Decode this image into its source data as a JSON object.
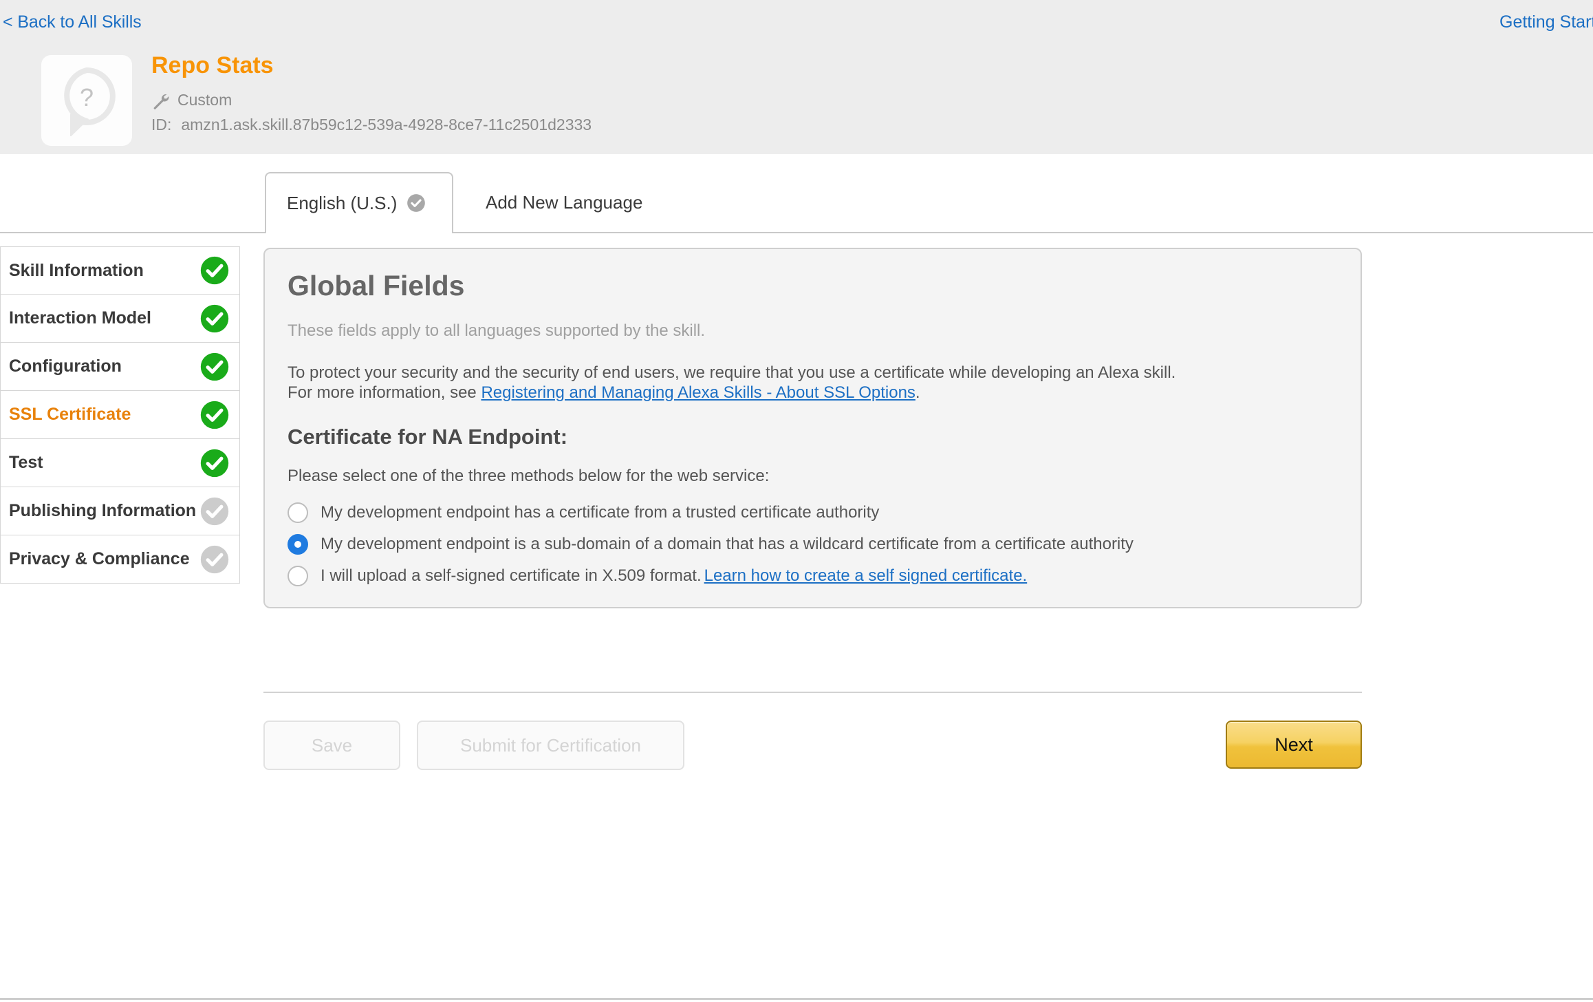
{
  "header": {
    "back_link": "< Back to All Skills",
    "getting_started_link": "Getting Started",
    "skill_name": "Repo Stats",
    "skill_type": "Custom",
    "skill_id_label": "ID:",
    "skill_id_value": "amzn1.ask.skill.87b59c12-539a-4928-8ce7-11c2501d2333",
    "icon_name": "speech-bubble-question-icon",
    "accent_color": "#f89406",
    "band_color": "#ededed"
  },
  "tabs": [
    {
      "label": "English (U.S.)",
      "active": true,
      "has_check": true
    },
    {
      "label": "Add New Language",
      "active": false,
      "has_check": false
    }
  ],
  "sidebar": {
    "items": [
      {
        "label": "Skill Information",
        "status": "complete",
        "current": false
      },
      {
        "label": "Interaction Model",
        "status": "complete",
        "current": false
      },
      {
        "label": "Configuration",
        "status": "complete",
        "current": false
      },
      {
        "label": "SSL Certificate",
        "status": "complete",
        "current": true
      },
      {
        "label": "Test",
        "status": "complete",
        "current": false
      },
      {
        "label": "Publishing Information",
        "status": "incomplete",
        "current": false
      },
      {
        "label": "Privacy & Compliance",
        "status": "incomplete",
        "current": false
      }
    ],
    "complete_color": "#1aab1a",
    "incomplete_color": "#cccccc",
    "current_color": "#e8820c"
  },
  "panel": {
    "title": "Global Fields",
    "subtitle": "These fields apply to all languages supported by the skill.",
    "paragraph_line1": "To protect your security and the security of end users, we require that you use a certificate while developing an Alexa skill.",
    "paragraph_line2_prefix": "For more information, see ",
    "paragraph_link": "Registering and Managing Alexa Skills - About SSL Options",
    "paragraph_line2_suffix": ".",
    "section_title": "Certificate for NA Endpoint:",
    "instruction": "Please select one of the three methods below for the web service:",
    "options": [
      {
        "label": "My development endpoint has a certificate from a trusted certificate authority",
        "selected": false,
        "link": ""
      },
      {
        "label": "My development endpoint is a sub-domain of a domain that has a wildcard certificate from a certificate authority",
        "selected": true,
        "link": ""
      },
      {
        "label": "I will upload a self-signed certificate in X.509 format.",
        "selected": false,
        "link": "Learn how to create a self signed certificate."
      }
    ],
    "link_color": "#1c6fc4",
    "background_color": "#f4f4f4"
  },
  "footer": {
    "save_label": "Save",
    "submit_label": "Submit for Certification",
    "next_label": "Next",
    "next_color": "#f0c23c"
  }
}
